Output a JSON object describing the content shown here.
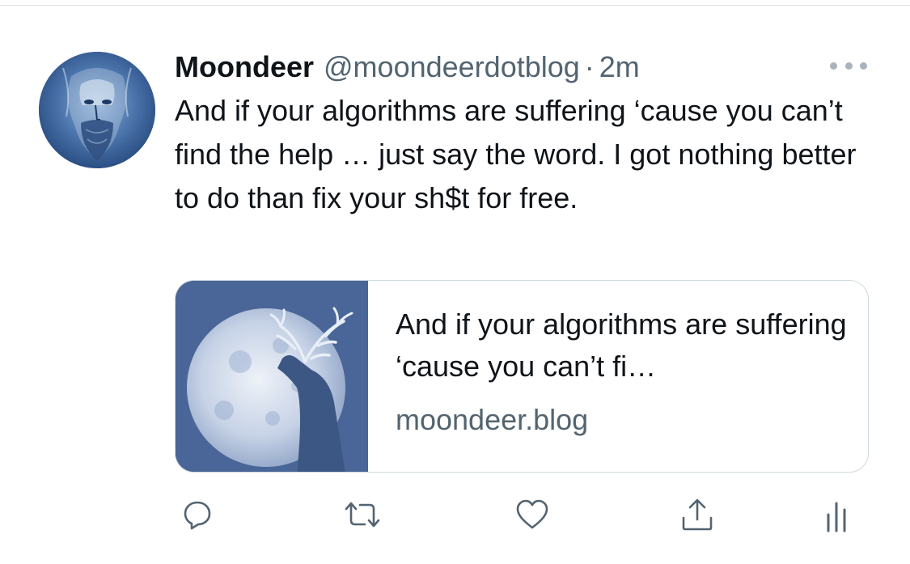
{
  "tweet": {
    "display_name": "Moondeer",
    "handle": "@moondeerdotblog",
    "separator": "·",
    "time": "2m",
    "avatar_icon": "bearded-face-avatar",
    "text": "And if your algorithms are suffering ‘cause you can’t find the help … just say the word. I got nothing better to do than fix your sh$t for free."
  },
  "card": {
    "image_icon": "deer-moon-image",
    "title": "And if your algorithms are suffering ‘cause you can’t fi…",
    "domain": "moondeer.blog"
  },
  "actions": [
    {
      "name": "reply",
      "icon": "reply-icon"
    },
    {
      "name": "retweet",
      "icon": "retweet-icon"
    },
    {
      "name": "like",
      "icon": "heart-icon"
    },
    {
      "name": "share",
      "icon": "share-icon"
    },
    {
      "name": "analytics",
      "icon": "analytics-icon"
    }
  ],
  "colors": {
    "text": "#0f1419",
    "secondary": "#536471",
    "border": "#cfd9de",
    "icon": "#536471"
  }
}
